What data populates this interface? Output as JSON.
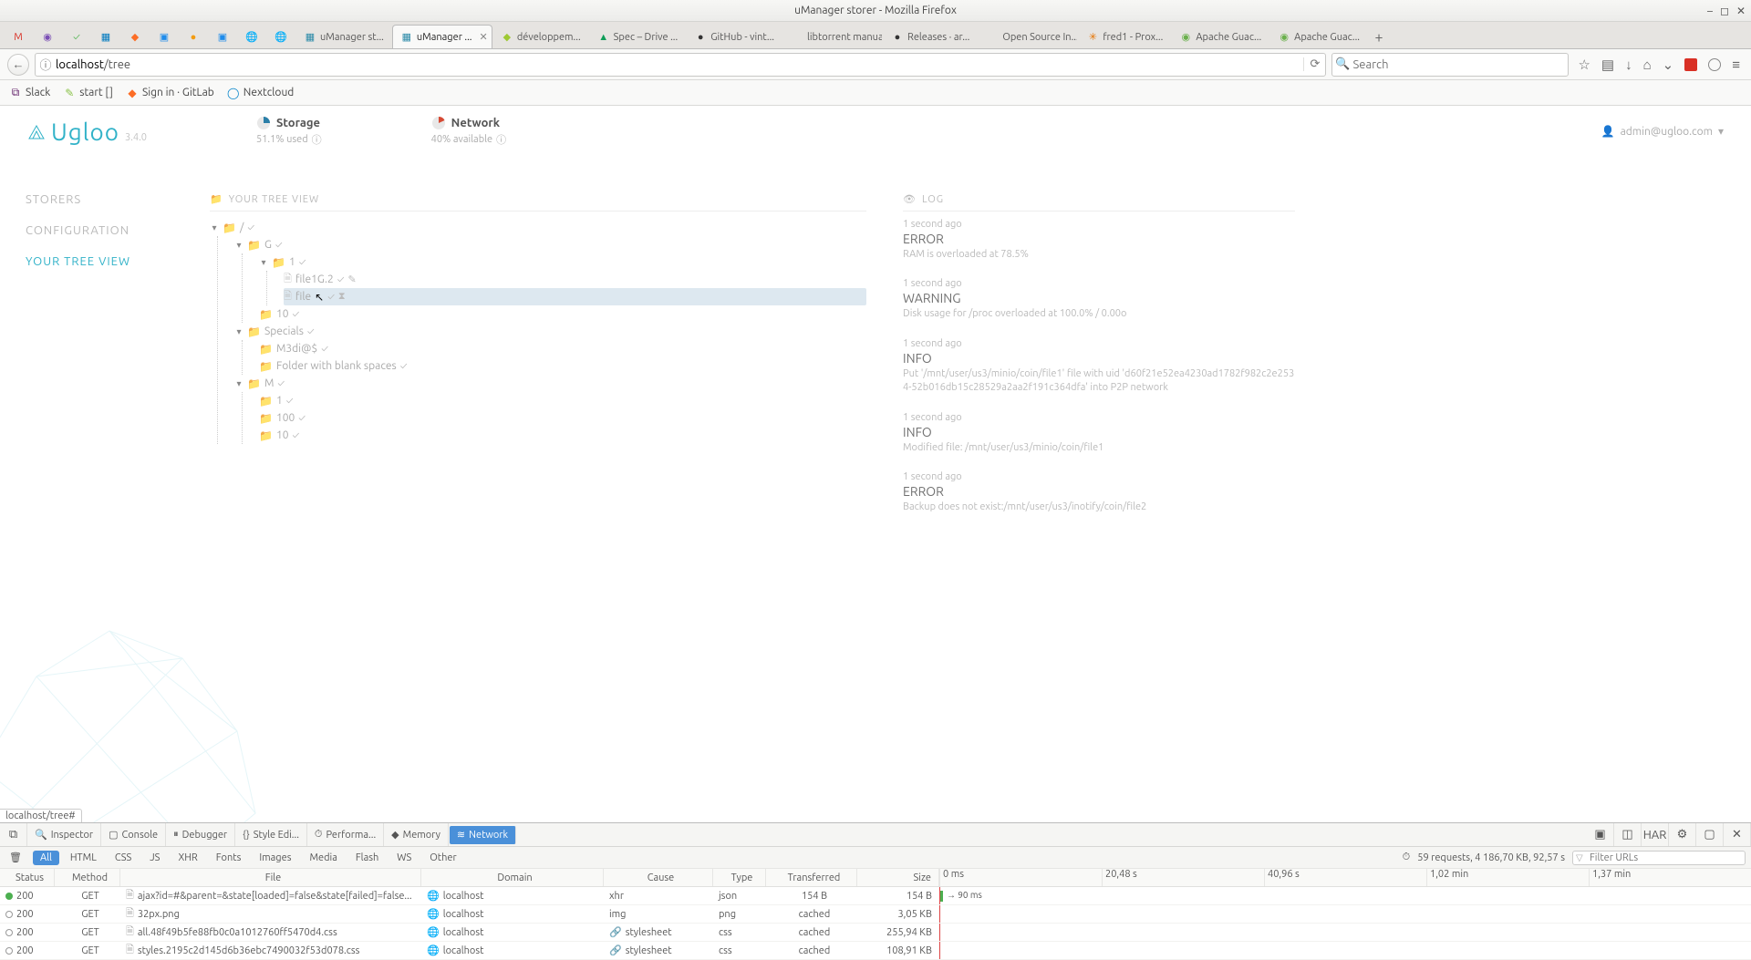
{
  "window": {
    "title": "uManager storer - Mozilla Firefox"
  },
  "tabs": [
    {
      "icon": "gmail",
      "label": "",
      "iconChar": "M",
      "iconColor": "#d93025"
    },
    {
      "icon": "purple",
      "label": "",
      "iconChar": "◉",
      "iconColor": "#7b4fb5"
    },
    {
      "icon": "green",
      "label": "",
      "iconChar": "✓",
      "iconColor": "#5bb85b"
    },
    {
      "icon": "trello",
      "label": "",
      "iconChar": "▦",
      "iconColor": "#0079bf"
    },
    {
      "icon": "gitlab",
      "label": "",
      "iconChar": "◆",
      "iconColor": "#fc6d26"
    },
    {
      "icon": "blue",
      "label": "",
      "iconChar": "▣",
      "iconColor": "#1f8ceb"
    },
    {
      "icon": "orange",
      "label": "",
      "iconChar": "●",
      "iconColor": "#f39c12"
    },
    {
      "icon": "teal",
      "label": "",
      "iconChar": "▣",
      "iconColor": "#1f8ceb"
    },
    {
      "icon": "globe1",
      "label": "",
      "iconChar": "🌐",
      "iconColor": "#888"
    },
    {
      "icon": "globe2",
      "label": "",
      "iconChar": "🌐",
      "iconColor": "#888"
    },
    {
      "icon": "um1",
      "label": "uManager st...",
      "iconChar": "▦",
      "iconColor": "#2b8aa8"
    },
    {
      "icon": "um2",
      "label": "uManager ...",
      "iconChar": "▦",
      "iconColor": "#2b8aa8",
      "active": true,
      "closable": true
    },
    {
      "icon": "dev",
      "label": "développem...",
      "iconChar": "◆",
      "iconColor": "#9ec933"
    },
    {
      "icon": "drive",
      "label": "Spec – Drive ...",
      "iconChar": "▲",
      "iconColor": "#0f9d58"
    },
    {
      "icon": "github",
      "label": "GitHub - vint...",
      "iconChar": "●",
      "iconColor": "#333"
    },
    {
      "icon": "lt",
      "label": "libtorrent manual",
      "iconChar": "",
      "iconColor": "#888"
    },
    {
      "icon": "github2",
      "label": "Releases · ar...",
      "iconChar": "●",
      "iconColor": "#333"
    },
    {
      "icon": "osi",
      "label": "Open Source In...",
      "iconChar": "",
      "iconColor": "#888"
    },
    {
      "icon": "prox",
      "label": "fred1 - Prox...",
      "iconChar": "✳",
      "iconColor": "#e57300"
    },
    {
      "icon": "guac1",
      "label": "Apache Guac...",
      "iconChar": "◉",
      "iconColor": "#6ab04c"
    },
    {
      "icon": "guac2",
      "label": "Apache Guac...",
      "iconChar": "◉",
      "iconColor": "#6ab04c"
    }
  ],
  "url": {
    "host": "localhost",
    "path": "/tree"
  },
  "search": {
    "placeholder": "Search"
  },
  "bookmarks": [
    {
      "label": "Slack",
      "iconChar": "⧉",
      "iconColor": "#611f69"
    },
    {
      "label": "start []",
      "iconChar": "✎",
      "iconColor": "#8bc34a"
    },
    {
      "label": "Sign in · GitLab",
      "iconChar": "◆",
      "iconColor": "#fc6d26"
    },
    {
      "label": "Nextcloud",
      "iconChar": "◯",
      "iconColor": "#0082c9"
    }
  ],
  "app": {
    "name": "Ugloo",
    "version": "3.4.0",
    "storage": {
      "label": "Storage",
      "sub": "51.1% used"
    },
    "network": {
      "label": "Network",
      "sub": "40% available"
    },
    "user": "admin@ugloo.com"
  },
  "sidebar": [
    {
      "label": "STORERS",
      "active": false
    },
    {
      "label": "CONFIGURATION",
      "active": false
    },
    {
      "label": "YOUR TREE VIEW",
      "active": true
    }
  ],
  "tree": {
    "title": "YOUR TREE VIEW",
    "root": "/",
    "nodes": {
      "G": "G",
      "one": "1",
      "file1G2": "file1G.2",
      "file_sel": "file ",
      "ten": "10",
      "specials": "Specials",
      "m3di": "M3di@$",
      "blank": "Folder with blank spaces",
      "M": "M",
      "m_one": "1",
      "m_100": "100",
      "m_10": "10"
    }
  },
  "log": {
    "title": "LOG",
    "items": [
      {
        "time": "1 second ago",
        "level": "ERROR",
        "msg": "RAM is overloaded at 78.5%"
      },
      {
        "time": "1 second ago",
        "level": "WARNING",
        "msg": "Disk usage for /proc overloaded at 100.0% / 0.00o"
      },
      {
        "time": "1 second ago",
        "level": "INFO",
        "msg": "Put '/mnt/user/us3/minio/coin/file1' file with uid 'd60f21e52ea4230ad1782f982c2e2534-52b016db15c28529a2aa2f191c364dfa' into P2P network"
      },
      {
        "time": "1 second ago",
        "level": "INFO",
        "msg": "Modified file: /mnt/user/us3/minio/coin/file1"
      },
      {
        "time": "1 second ago",
        "level": "ERROR",
        "msg": "Backup does not exist:/mnt/user/us3/inotify/coin/file2"
      }
    ]
  },
  "statuslink": "localhost/tree#",
  "devtools": {
    "tabs": [
      "Inspector",
      "Console",
      "Debugger",
      "Style Edi...",
      "Performa...",
      "Memory",
      "Network"
    ],
    "activeTab": "Network",
    "filters": [
      "All",
      "HTML",
      "CSS",
      "JS",
      "XHR",
      "Fonts",
      "Images",
      "Media",
      "Flash",
      "WS",
      "Other"
    ],
    "activeFilter": "All",
    "summary": "59 requests, 4 186,70 KB, 92,57 s",
    "filterPlaceholder": "Filter URLs",
    "columns": [
      "Status",
      "Method",
      "File",
      "Domain",
      "Cause",
      "Type",
      "Transferred",
      "Size"
    ],
    "ticks": [
      "0 ms",
      "20,48 s",
      "40,96 s",
      "1,02 min",
      "1,37 min"
    ],
    "rows": [
      {
        "dot": "green",
        "status": "200",
        "method": "GET",
        "file": "ajax?id=#&parent=&state[loaded]=false&state[failed]=false...",
        "domain": "localhost",
        "cause": "xhr",
        "type": "json",
        "trans": "154 B",
        "size": "154 B",
        "bar": "→ 90 ms"
      },
      {
        "dot": "gray",
        "status": "200",
        "method": "GET",
        "file": "32px.png",
        "domain": "localhost",
        "cause": "img",
        "type": "png",
        "trans": "cached",
        "size": "3,05 KB",
        "bar": ""
      },
      {
        "dot": "gray",
        "status": "200",
        "method": "GET",
        "file": "all.48f49b5fe88fb0c0a1012760ff5470d4.css",
        "domain": "localhost",
        "cause": "stylesheet",
        "type": "css",
        "trans": "cached",
        "size": "255,94 KB",
        "bar": ""
      },
      {
        "dot": "gray",
        "status": "200",
        "method": "GET",
        "file": "styles.2195c2d145d6b36ebc7490032f53d078.css",
        "domain": "localhost",
        "cause": "stylesheet",
        "type": "css",
        "trans": "cached",
        "size": "108,91 KB",
        "bar": ""
      }
    ]
  }
}
